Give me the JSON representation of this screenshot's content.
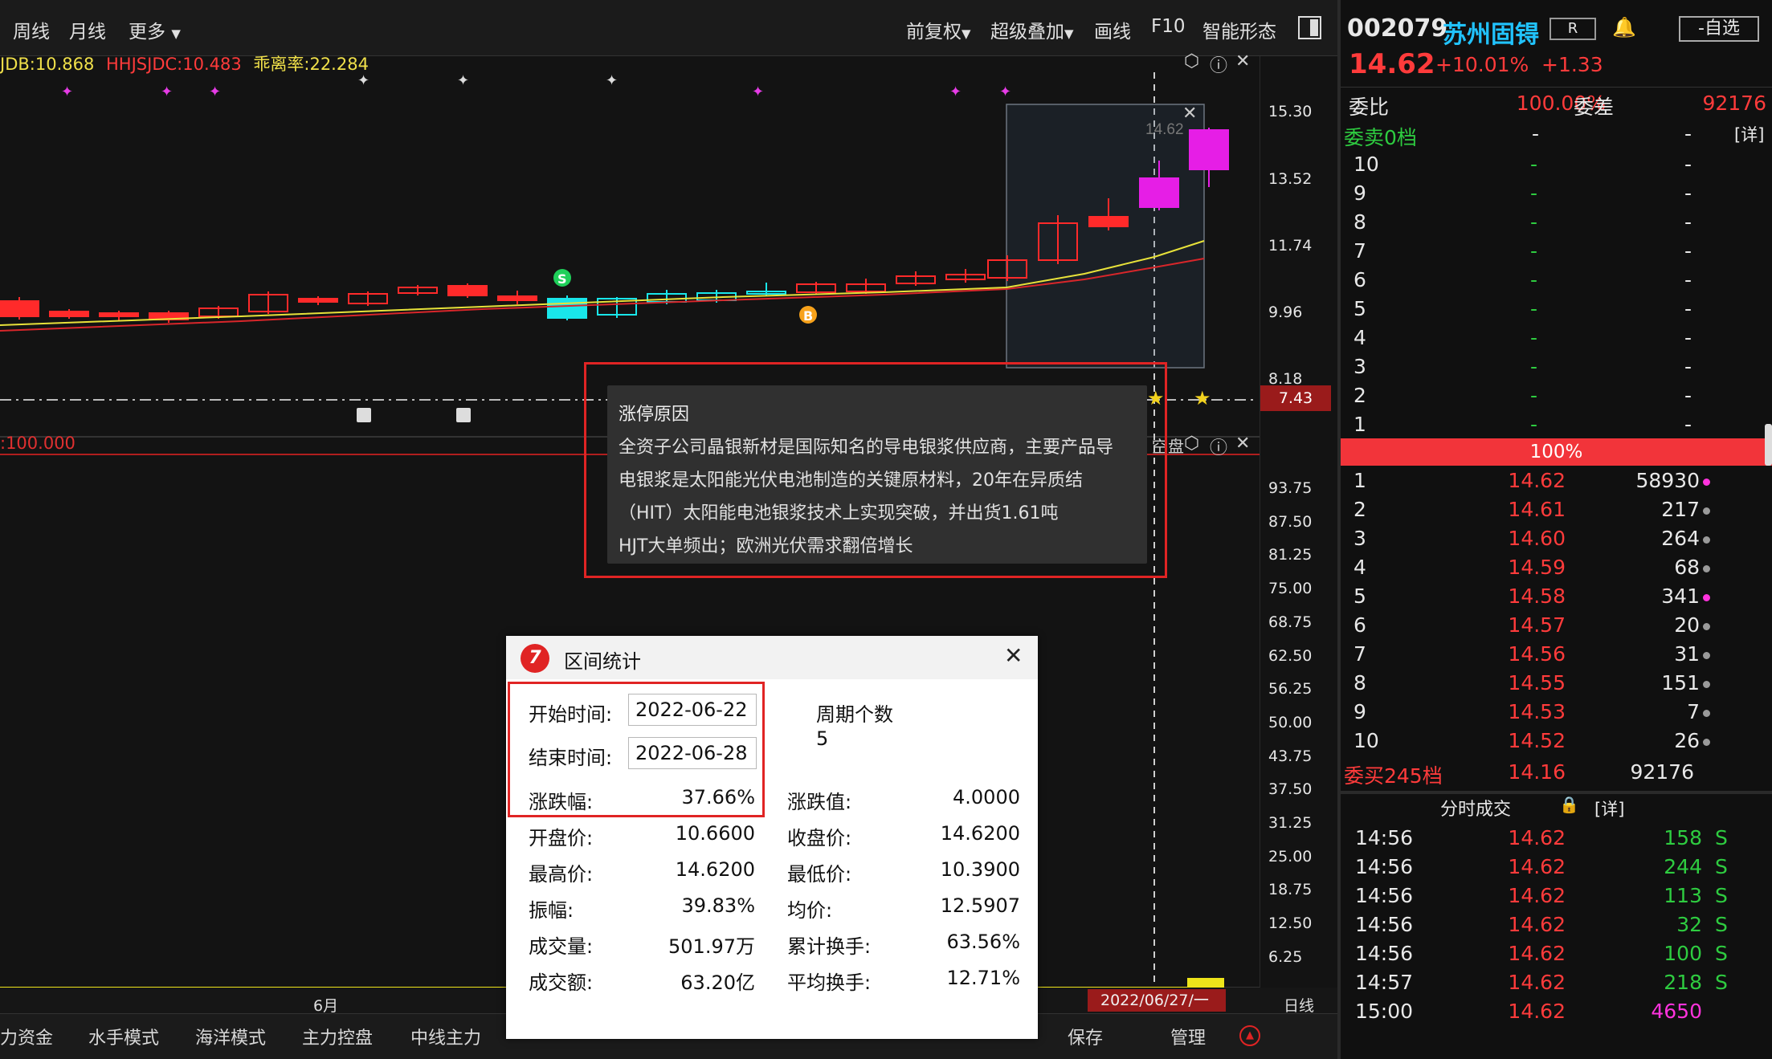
{
  "toolbar": {
    "left_items": [
      "周线",
      "月线",
      "更多"
    ],
    "right_items": [
      "前复权",
      "超级叠加",
      "画线",
      "F10",
      "智能形态"
    ]
  },
  "legend": {
    "a": "JDB:10.868",
    "b": "HHJSJDC:10.483",
    "c": "乖离率:22.284"
  },
  "indicator_legend": ":100.000",
  "price_ticks": [
    "15.30",
    "13.52",
    "11.74",
    "9.96",
    "8.18"
  ],
  "price_marker": "7.43",
  "indicator_ticks": [
    "93.75",
    "87.50",
    "81.25",
    "75.00",
    "68.75",
    "62.50",
    "56.25",
    "50.00",
    "43.75",
    "37.50",
    "31.25",
    "25.00",
    "18.75",
    "12.50",
    "6.25"
  ],
  "chart_labels": {
    "last_price": "14.62",
    "buy_marker": "B",
    "sell_marker": "S",
    "panel_tag": "空盘"
  },
  "tooltip": {
    "title": "涨停原因",
    "lines": [
      "全资子公司晶银新材是国际知名的导电银浆供应商，主要产品导",
      "电银浆是太阳能光伏电池制造的关键原材料，20年在异质结",
      "（HIT）太阳能电池银浆技术上实现突破，并出货1.61吨",
      "HJT大单频出；欧洲光伏需求翻倍增长"
    ]
  },
  "stats": {
    "title": "区间统计",
    "start_label": "开始时间:",
    "start": "2022-06-22",
    "end_label": "结束时间:",
    "end": "2022-06-28",
    "period_label": "周期个数",
    "period": "5",
    "rows": [
      {
        "l1": "涨跌幅:",
        "v1": "37.66%",
        "l2": "涨跌值:",
        "v2": "4.0000"
      },
      {
        "l1": "开盘价:",
        "v1": "10.6600",
        "l2": "收盘价:",
        "v2": "14.6200"
      },
      {
        "l1": "最高价:",
        "v1": "14.6200",
        "l2": "最低价:",
        "v2": "10.3900"
      },
      {
        "l1": "振幅:",
        "v1": "39.83%",
        "l2": "均价:",
        "v2": "12.5907"
      },
      {
        "l1": "成交量:",
        "v1": "501.97万",
        "l2": "累计换手:",
        "v2": "63.56%"
      },
      {
        "l1": "成交额:",
        "v1": "63.20亿",
        "l2": "平均换手:",
        "v2": "12.71%"
      }
    ]
  },
  "date_axis": {
    "month": "6月",
    "cursor_date": "2022/06/27/一",
    "period": "日线"
  },
  "bottom_tabs": [
    "力资金",
    "水手模式",
    "海洋模式",
    "主力控盘",
    "中线主力",
    "保存",
    "管理"
  ],
  "quote": {
    "code": "002079",
    "name": "苏州固锝",
    "r_tag": "R",
    "watch": "-自选",
    "price": "14.62",
    "pct": "+10.01%",
    "chg": "+1.33",
    "weibi_label": "委比",
    "weibi": "100.00%",
    "weicha_label": "委差",
    "weicha": "92176",
    "sell_head": "委卖0档",
    "detail": "[详]",
    "sell_levels": [
      "10",
      "9",
      "8",
      "7",
      "6",
      "5",
      "4",
      "3",
      "2",
      "1"
    ],
    "dash": "-",
    "bar_label": "100%",
    "buy": [
      {
        "n": "1",
        "p": "14.62",
        "v": "58930",
        "dot": "mag"
      },
      {
        "n": "2",
        "p": "14.61",
        "v": "217",
        "dot": "gray"
      },
      {
        "n": "3",
        "p": "14.60",
        "v": "264",
        "dot": "gray"
      },
      {
        "n": "4",
        "p": "14.59",
        "v": "68",
        "dot": "gray"
      },
      {
        "n": "5",
        "p": "14.58",
        "v": "341",
        "dot": "mag"
      },
      {
        "n": "6",
        "p": "14.57",
        "v": "20",
        "dot": "gray"
      },
      {
        "n": "7",
        "p": "14.56",
        "v": "31",
        "dot": "gray"
      },
      {
        "n": "8",
        "p": "14.55",
        "v": "151",
        "dot": "gray"
      },
      {
        "n": "9",
        "p": "14.53",
        "v": "7",
        "dot": "gray"
      },
      {
        "n": "10",
        "p": "14.52",
        "v": "26",
        "dot": "gray"
      }
    ],
    "buy_head": "委买245档",
    "buy_avg": "14.16",
    "buy_total": "92176",
    "ticks_head": "分时成交",
    "ticks_detail": "[详]",
    "ticks": [
      {
        "t": "14:56",
        "p": "14.62",
        "v": "158",
        "s": "S"
      },
      {
        "t": "14:56",
        "p": "14.62",
        "v": "244",
        "s": "S"
      },
      {
        "t": "14:56",
        "p": "14.62",
        "v": "113",
        "s": "S"
      },
      {
        "t": "14:56",
        "p": "14.62",
        "v": "32",
        "s": "S"
      },
      {
        "t": "14:56",
        "p": "14.62",
        "v": "100",
        "s": "S"
      },
      {
        "t": "14:57",
        "p": "14.62",
        "v": "218",
        "s": "S"
      },
      {
        "t": "15:00",
        "p": "14.62",
        "v": "4650",
        "s": ""
      }
    ]
  },
  "colors": {
    "up": "#ff2a2a",
    "down": "#19e6ea",
    "limit": "#e61ee6",
    "ma1": "#e8e23a",
    "ma2": "#d8262a"
  }
}
